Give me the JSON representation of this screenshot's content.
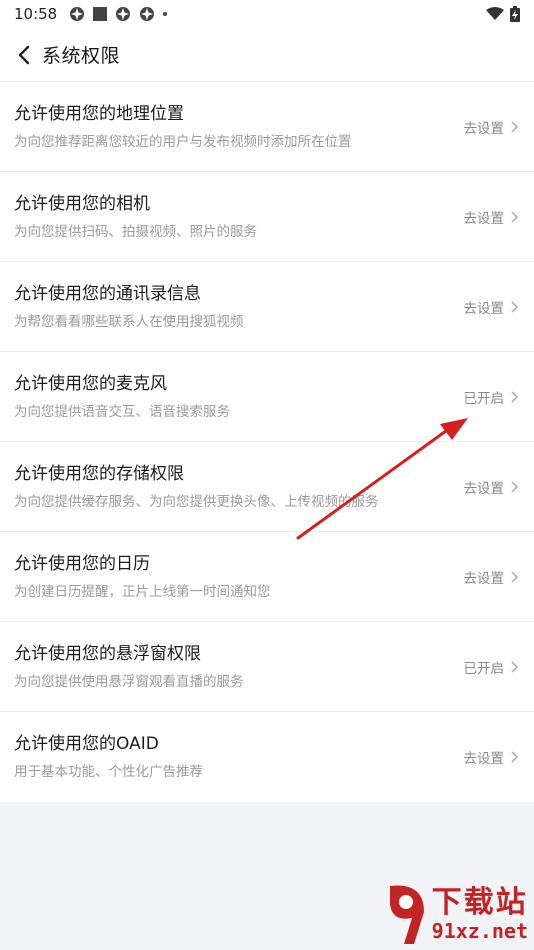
{
  "status_bar": {
    "time": "10:58"
  },
  "nav": {
    "title": "系统权限"
  },
  "permissions": [
    {
      "title": "允许使用您的地理位置",
      "desc": "为向您推荐距离您较近的用户与发布视频时添加所在位置",
      "action": "去设置"
    },
    {
      "title": "允许使用您的相机",
      "desc": "为向您提供扫码、拍摄视频、照片的服务",
      "action": "去设置"
    },
    {
      "title": "允许使用您的通讯录信息",
      "desc": "为帮您看看哪些联系人在使用搜狐视频",
      "action": "去设置"
    },
    {
      "title": "允许使用您的麦克风",
      "desc": "为向您提供语音交互、语音搜索服务",
      "action": "已开启"
    },
    {
      "title": "允许使用您的存储权限",
      "desc": "为向您提供缓存服务、为向您提供更换头像、上传视频的服务",
      "action": "去设置"
    },
    {
      "title": "允许使用您的日历",
      "desc": "为创建日历提醒，正片上线第一时间通知您",
      "action": "去设置"
    },
    {
      "title": "允许使用您的悬浮窗权限",
      "desc": "为向您提供使用悬浮窗观看直播的服务",
      "action": "已开启"
    },
    {
      "title": "允许使用您的OAID",
      "desc": "用于基本功能、个性化广告推荐",
      "action": "去设置"
    }
  ],
  "watermark": {
    "cn": "下载站",
    "en": "91xz.net"
  },
  "colors": {
    "annotation_arrow": "#d42020",
    "watermark": "#c22424"
  }
}
